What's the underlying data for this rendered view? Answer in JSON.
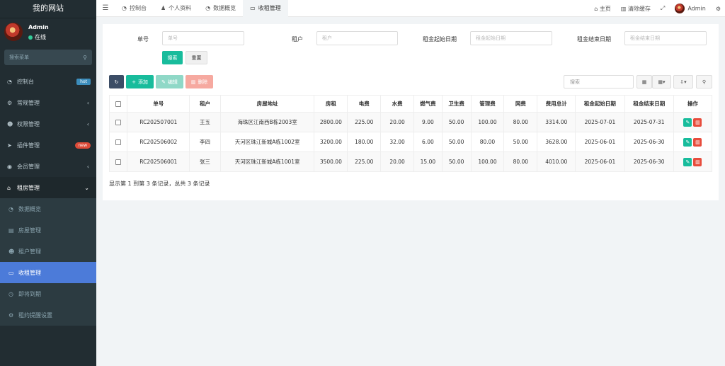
{
  "site": {
    "title": "我的网站"
  },
  "user": {
    "name": "Admin",
    "status": "在线"
  },
  "sidebar": {
    "search_placeholder": "搜索菜单",
    "items": [
      {
        "label": "控制台",
        "icon": "dashboard-icon",
        "badge": "hot"
      },
      {
        "label": "常规管理",
        "icon": "cogs-icon",
        "chevron": "‹"
      },
      {
        "label": "权限管理",
        "icon": "group-icon",
        "chevron": "‹"
      },
      {
        "label": "插件管理",
        "icon": "rocket-icon",
        "badge": "new"
      },
      {
        "label": "会员管理",
        "icon": "user-circle-icon",
        "chevron": "‹"
      },
      {
        "label": "租房管理",
        "icon": "home-icon",
        "chevron": "⌄"
      }
    ],
    "subitems": [
      {
        "label": "数据概览",
        "icon": "dashboard-icon"
      },
      {
        "label": "房屋管理",
        "icon": "building-icon"
      },
      {
        "label": "租户管理",
        "icon": "users-icon"
      },
      {
        "label": "收租管理",
        "icon": "money-icon"
      },
      {
        "label": "即将到期",
        "icon": "clock-icon"
      },
      {
        "label": "租约提醒设置",
        "icon": "gear-icon"
      }
    ]
  },
  "topbar": {
    "tabs": [
      {
        "label": "控制台",
        "icon": "dashboard-icon"
      },
      {
        "label": "个人资料",
        "icon": "user-icon"
      },
      {
        "label": "数据概览",
        "icon": "dashboard-icon"
      },
      {
        "label": "收租管理",
        "icon": "money-icon"
      }
    ],
    "home": "主页",
    "clear_cache": "清除缓存",
    "admin": "Admin"
  },
  "filters": {
    "bill_no": {
      "label": "单号",
      "placeholder": "单号"
    },
    "tenant": {
      "label": "租户",
      "placeholder": "租户"
    },
    "start_date": {
      "label": "租金起始日期",
      "placeholder": "租金起始日期"
    },
    "end_date": {
      "label": "租金结束日期",
      "placeholder": "租金结束日期"
    },
    "search_btn": "搜索",
    "reset_btn": "重置"
  },
  "toolbar": {
    "add": "添加",
    "edit": "编辑",
    "delete": "删除",
    "search_placeholder": "搜索"
  },
  "table": {
    "headers": [
      "单号",
      "租户",
      "房屋地址",
      "房租",
      "电费",
      "水费",
      "燃气费",
      "卫生费",
      "管理费",
      "网费",
      "费用总计",
      "租金起始日期",
      "租金结束日期",
      "操作"
    ],
    "rows": [
      [
        "RC202507001",
        "王五",
        "海珠区江南西B栋2003室",
        "2800.00",
        "225.00",
        "20.00",
        "9.00",
        "50.00",
        "100.00",
        "80.00",
        "3314.00",
        "2025-07-01",
        "2025-07-31"
      ],
      [
        "RC202506002",
        "李四",
        "天河区珠江新城A栋1002室",
        "3200.00",
        "180.00",
        "32.00",
        "6.00",
        "50.00",
        "80.00",
        "50.00",
        "3628.00",
        "2025-06-01",
        "2025-06-30"
      ],
      [
        "RC202506001",
        "张三",
        "天河区珠江新城A栋1001室",
        "3500.00",
        "225.00",
        "20.00",
        "15.00",
        "50.00",
        "100.00",
        "80.00",
        "4010.00",
        "2025-06-01",
        "2025-06-30"
      ]
    ]
  },
  "pagination": {
    "info": "显示第 1 到第 3 条记录，总共 3 条记录"
  }
}
